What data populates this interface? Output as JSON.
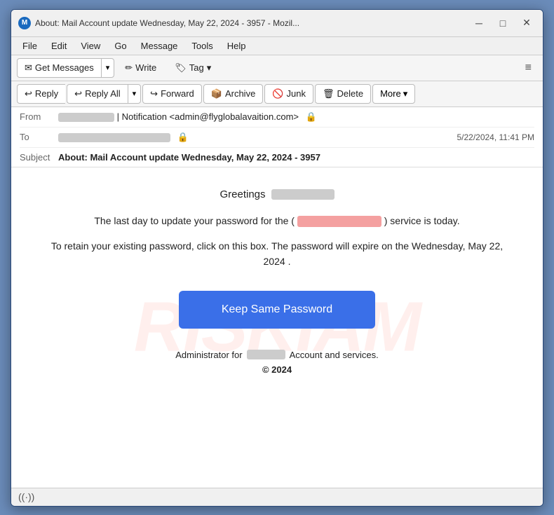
{
  "window": {
    "title": "About: Mail Account update Wednesday, May 22, 2024 - 3957 - Mozil...",
    "icon_label": "M"
  },
  "title_buttons": {
    "minimize": "─",
    "maximize": "□",
    "close": "✕"
  },
  "menu": {
    "items": [
      "File",
      "Edit",
      "View",
      "Go",
      "Message",
      "Tools",
      "Help"
    ]
  },
  "toolbar": {
    "get_messages_label": "Get Messages",
    "write_label": "Write",
    "tag_label": "Tag",
    "hamburger": "≡"
  },
  "action_bar": {
    "reply_label": "Reply",
    "reply_all_label": "Reply All",
    "forward_label": "Forward",
    "archive_label": "Archive",
    "junk_label": "Junk",
    "delete_label": "Delete",
    "more_label": "More"
  },
  "email_header": {
    "from_label": "From",
    "from_value": "| Notification <admin@flyglobalavaition.com>",
    "to_label": "To",
    "timestamp": "5/22/2024, 11:41 PM",
    "subject_label": "Subject",
    "subject_value": "About: Mail Account update Wednesday, May 22, 2024 - 3957"
  },
  "email_body": {
    "watermark": "RISKIAM",
    "greeting": "Greetings",
    "body1": "The last day to update your password for the (",
    "body1_end": ") service is today.",
    "body2": "To retain your existing password, click on this box. The password will expire on the Wednesday, May 22, 2024 .",
    "cta_button": "Keep Same Password",
    "footer1_pre": "Administrator for",
    "footer1_post": "Account and services.",
    "footer2": "© 2024"
  },
  "status_bar": {
    "signal_icon": "((·))"
  }
}
